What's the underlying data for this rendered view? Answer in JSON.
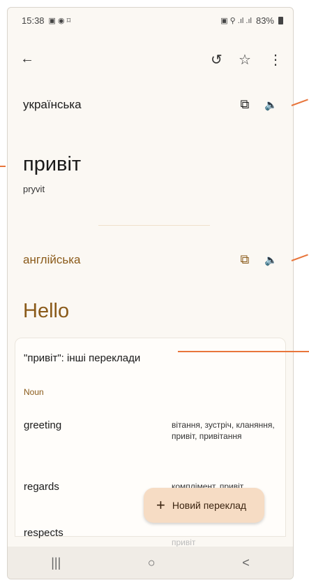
{
  "status_bar": {
    "time": "15:38",
    "left_icons": "▣ ◉ ⌑",
    "right_icons": "▣ ⚲ .ıl .ıl",
    "battery": "83%"
  },
  "app_bar": {
    "back_icon": "←",
    "history_icon": "↺",
    "star_icon": "☆",
    "more_icon": "⋮"
  },
  "source": {
    "language": "українська",
    "word": "привіт",
    "transliteration": "pryvit",
    "copy_icon": "⧉",
    "speaker_icon": "🔈"
  },
  "target": {
    "language": "англійська",
    "word": "Hello",
    "copy_icon": "⧉",
    "speaker_icon": "🔈"
  },
  "other_translations": {
    "title": "\"привіт\": інші переклади",
    "part_of_speech": "Noun",
    "rows": [
      {
        "word": "greeting",
        "synonyms": "вітання, зустріч, кланяння, привіт, привітання"
      },
      {
        "word": "regards",
        "synonyms": "комплімент, привіт,"
      },
      {
        "word": "respects",
        "synonyms": "привіт"
      }
    ]
  },
  "fab": {
    "icon": "+",
    "label": "Новий переклад"
  },
  "nav": {
    "recents": "|||",
    "home": "○",
    "back": "<"
  },
  "colors": {
    "accent": "#8a5a19",
    "callout": "#e8753b",
    "fab_bg": "#f6dcc4"
  }
}
